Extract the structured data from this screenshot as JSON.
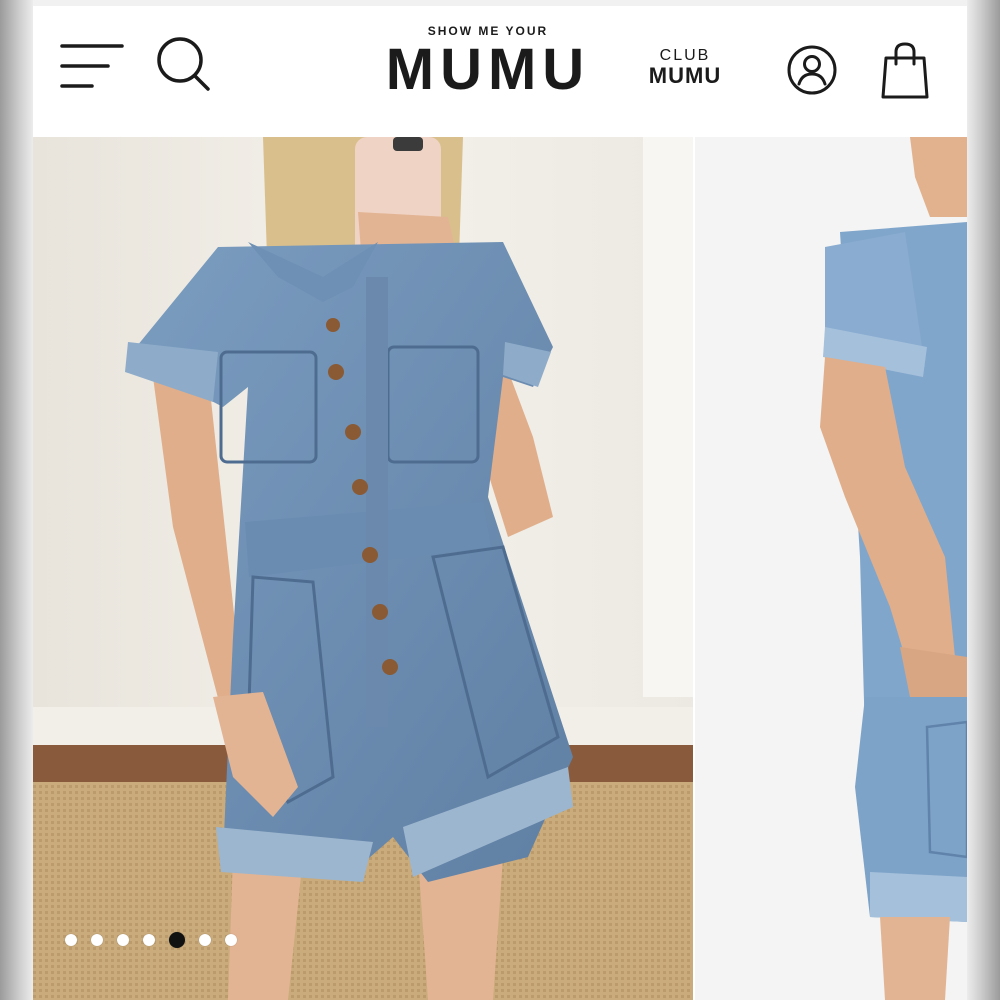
{
  "header": {
    "logo_tagline": "SHOW ME YOUR",
    "logo_name": "MUMU",
    "club_top": "CLUB",
    "club_main": "MUMU",
    "icons": [
      "menu-icon",
      "search-icon",
      "account-icon",
      "shopping-bag-icon"
    ]
  },
  "carousel": {
    "slide_count": 7,
    "active_index": 4,
    "colors": {
      "denim": "#7b9dc0",
      "accent_dot": "#111111"
    }
  }
}
